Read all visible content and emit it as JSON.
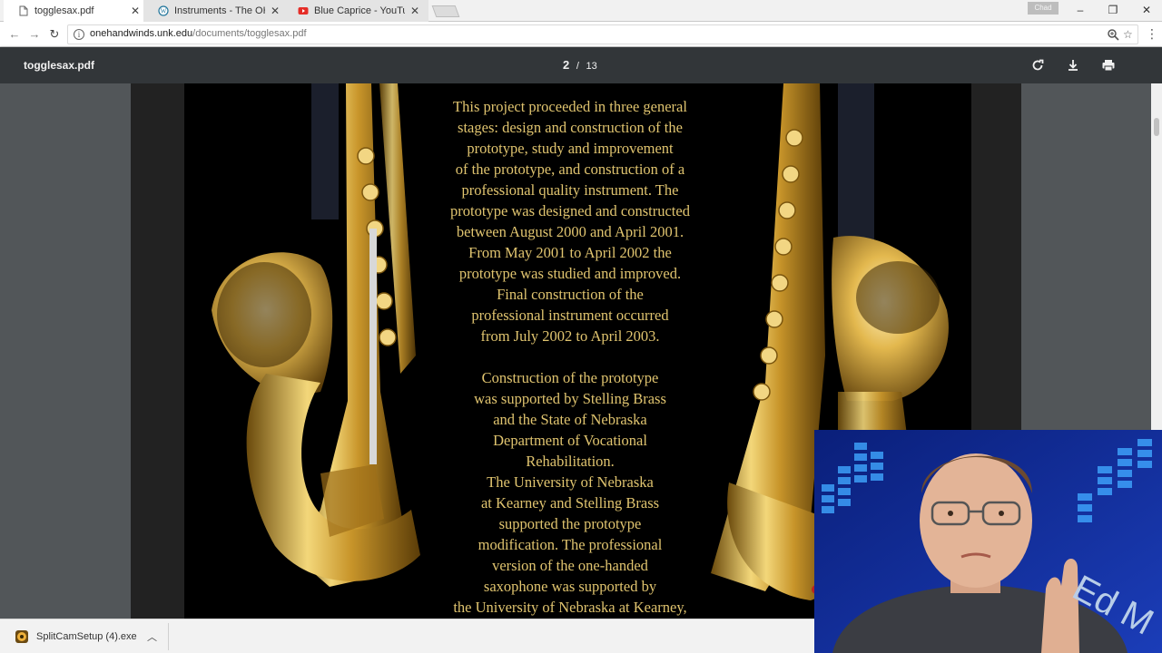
{
  "browser": {
    "tabs": [
      {
        "title": "togglesax.pdf",
        "icon": "document-icon",
        "active": true
      },
      {
        "title": "Instruments - The OHMI",
        "icon": "wordpress-icon",
        "active": false
      },
      {
        "title": "Blue Caprice - YouTube",
        "icon": "youtube-icon",
        "active": false
      }
    ],
    "profile_label": "Chad",
    "url_host": "onehandwinds.unk.edu",
    "url_path": "/documents/togglesax.pdf"
  },
  "pdf": {
    "filename": "togglesax.pdf",
    "current_page": "2",
    "page_separator": "/",
    "total_pages": "13"
  },
  "slide": {
    "lines": [
      "This project proceeded in three general",
      "stages:  design and construction of the",
      "prototype, study and improvement",
      "of the prototype, and construction of a",
      "professional quality instrument.  The",
      "prototype was designed and constructed",
      "between August 2000 and April 2001.",
      "From May 2001 to April 2002 the",
      "prototype was studied and improved.",
      "Final construction of the",
      "professional instrument occurred",
      "from July 2002 to April 2003.",
      "",
      "Construction of the prototype",
      "was supported by Stelling Brass",
      "and the State of Nebraska",
      "Department of Vocational",
      "Rehabilitation.",
      "The University of Nebraska",
      "at Kearney and Stelling Brass",
      "supported the prototype",
      "modification.  The professional",
      "version of the one-handed",
      "saxophone was supported by",
      "the University of Nebraska at Kearney,"
    ]
  },
  "download": {
    "filename": "SplitCamSetup (4).exe"
  },
  "colors": {
    "pdf_toolbar": "#323639",
    "viewer_bg": "#525659",
    "slide_text": "#e0c46f",
    "brass": "#d4a832",
    "webcam_bg": "#0b1a66"
  }
}
